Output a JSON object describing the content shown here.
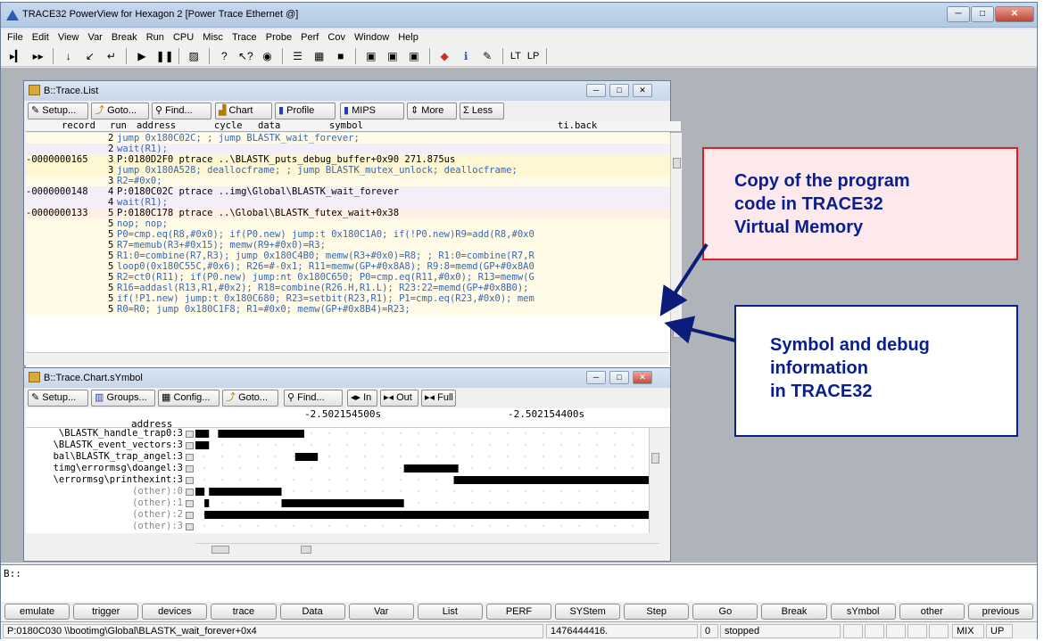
{
  "app": {
    "title": "TRACE32 PowerView for Hexagon 2 [Power Trace Ethernet @]"
  },
  "menu": [
    "File",
    "Edit",
    "View",
    "Var",
    "Break",
    "Run",
    "CPU",
    "Misc",
    "Trace",
    "Probe",
    "Perf",
    "Cov",
    "Window",
    "Help"
  ],
  "toolbar": {
    "lt_label": "LT",
    "lp_label": "LP"
  },
  "trace_list": {
    "title": "B::Trace.List",
    "buttons": [
      "Setup...",
      "Goto...",
      "Find...",
      "Chart",
      "Profile",
      "MIPS",
      "More",
      "Less"
    ],
    "headers": [
      "record",
      "run",
      "address",
      "cycle",
      "data",
      "symbol",
      "ti.back"
    ],
    "rows": [
      {
        "record": "",
        "run": "2",
        "code": "jump 0x180C02C;            ; jump BLASTK_wait_forever;",
        "bg": "#fffbe6"
      },
      {
        "record": "",
        "run": "2",
        "code": "wait(R1);",
        "bg": "#f4eef8"
      },
      {
        "record": "-0000000165",
        "run": "3",
        "code": "  P:0180D2F0 ptrace          ..\\BLASTK_puts_debug_buffer+0x90  271.875us",
        "bg": "#fff6d2"
      },
      {
        "record": "",
        "run": "3",
        "code": "jump 0x180A528; deallocframe; ; jump BLASTK_mutex_unlock; deallocframe;",
        "bg": "#fff6d2"
      },
      {
        "record": "",
        "run": "3",
        "code": "R2=#0x0;",
        "bg": "#fffbe6"
      },
      {
        "record": "-0000000148",
        "run": "4",
        "code": "  P:0180C02C ptrace          ..img\\Global\\BLASTK_wait_forever",
        "bg": "#f4eef8"
      },
      {
        "record": "",
        "run": "4",
        "code": "wait(R1);",
        "bg": "#f4eef8"
      },
      {
        "record": "-0000000133",
        "run": "5",
        "code": "  P:0180C178 ptrace          ..\\Global\\BLASTK_futex_wait+0x38",
        "bg": "#fff0e6"
      },
      {
        "record": "",
        "run": "5",
        "code": "nop; nop;",
        "bg": "#fffbe6"
      },
      {
        "record": "",
        "run": "5",
        "code": "P0=cmp.eq(R8,#0x0); if(P0.new) jump:t 0x180C1A0; if(!P0.new)R9=add(R8,#0x0",
        "bg": "#fffbe6"
      },
      {
        "record": "",
        "run": "5",
        "code": "R7=memub(R3+#0x15); memw(R9+#0x0)=R3;",
        "bg": "#fffbe6"
      },
      {
        "record": "",
        "run": "5",
        "code": "R1:0=combine(R7,R3); jump 0x180C4B0; memw(R3+#0x0)=R8; ; R1:0=combine(R7,R",
        "bg": "#fffbe6"
      },
      {
        "record": "",
        "run": "5",
        "code": "loop0(0x180C55C,#0x6); R26=#-0x1; R11=memw(GP+#0x8A8); R9:8=memd(GP+#0x8A0",
        "bg": "#fffbe6"
      },
      {
        "record": "",
        "run": "5",
        "code": "R2=ct0(R11); if(P0.new) jump:nt 0x180C650; P0=cmp.eq(R11,#0x0); R13=memw(G",
        "bg": "#fffbe6"
      },
      {
        "record": "",
        "run": "5",
        "code": "R16=addasl(R13,R1,#0x2); R18=combine(R26.H,R1.L); R23:22=memd(GP+#0x8B0);",
        "bg": "#fffbe6"
      },
      {
        "record": "",
        "run": "5",
        "code": "if(!P1.new) jump:t 0x180C680; R23=setbit(R23,R1); P1=cmp.eq(R23,#0x0); mem",
        "bg": "#fffbe6"
      },
      {
        "record": "",
        "run": "5",
        "code": "R0=R0; jump 0x180C1F8; R1=#0x0; memw(GP+#0x8B4)=R23;",
        "bg": "#fffbe6"
      }
    ]
  },
  "trace_chart": {
    "title": "B::Trace.Chart.sYmbol",
    "buttons": [
      "Setup...",
      "Groups...",
      "Config...",
      "Goto...",
      "Find...",
      "In",
      "Out",
      "Full"
    ],
    "time_labels": [
      "-2.502154500s",
      "-2.502154400s"
    ],
    "header_label": "address",
    "rows": [
      {
        "label": "\\BLASTK_handle_trap0:3",
        "segments": [
          [
            0,
            3
          ],
          [
            5,
            24
          ]
        ]
      },
      {
        "label": "\\BLASTK_event_vectors:3",
        "segments": [
          [
            0,
            3
          ]
        ]
      },
      {
        "label": "bal\\BLASTK_trap_angel:3",
        "segments": [
          [
            22,
            27
          ]
        ]
      },
      {
        "label": "timg\\errormsg\\doangel:3",
        "segments": [
          [
            46,
            58
          ]
        ]
      },
      {
        "label": "\\errormsg\\printhexint:3",
        "segments": [
          [
            57,
            100
          ]
        ]
      },
      {
        "label": "(other):0",
        "segments": [
          [
            0,
            2
          ],
          [
            3,
            19
          ]
        ]
      },
      {
        "label": "(other):1",
        "segments": [
          [
            2,
            3
          ],
          [
            19,
            46
          ]
        ]
      },
      {
        "label": "(other):2",
        "segments": [
          [
            2,
            100
          ]
        ]
      },
      {
        "label": "(other):3",
        "segments": []
      }
    ]
  },
  "callouts": {
    "copy": [
      "Copy of the program",
      "code in TRACE32",
      "Virtual Memory"
    ],
    "symbol": [
      "Symbol and debug",
      "information",
      "in TRACE32"
    ]
  },
  "command_line": {
    "prompt": "B::"
  },
  "softkeys": [
    "emulate",
    "trigger",
    "devices",
    "trace",
    "Data",
    "Var",
    "List",
    "PERF",
    "SYStem",
    "Step",
    "Go",
    "Break",
    "sYmbol",
    "other",
    "previous"
  ],
  "status": {
    "address": "P:0180C030  \\\\bootimg\\Global\\BLASTK_wait_forever+0x4",
    "counter": "1476444416.",
    "zero": "0",
    "state": "stopped",
    "mode": "MIX",
    "dir": "UP"
  },
  "colors": {
    "callout_red": "#e31b23",
    "callout_blue": "#0a1f8f",
    "callout_pink_bg": "#fde9ec",
    "arrow_navy": "#0b1c7a"
  }
}
